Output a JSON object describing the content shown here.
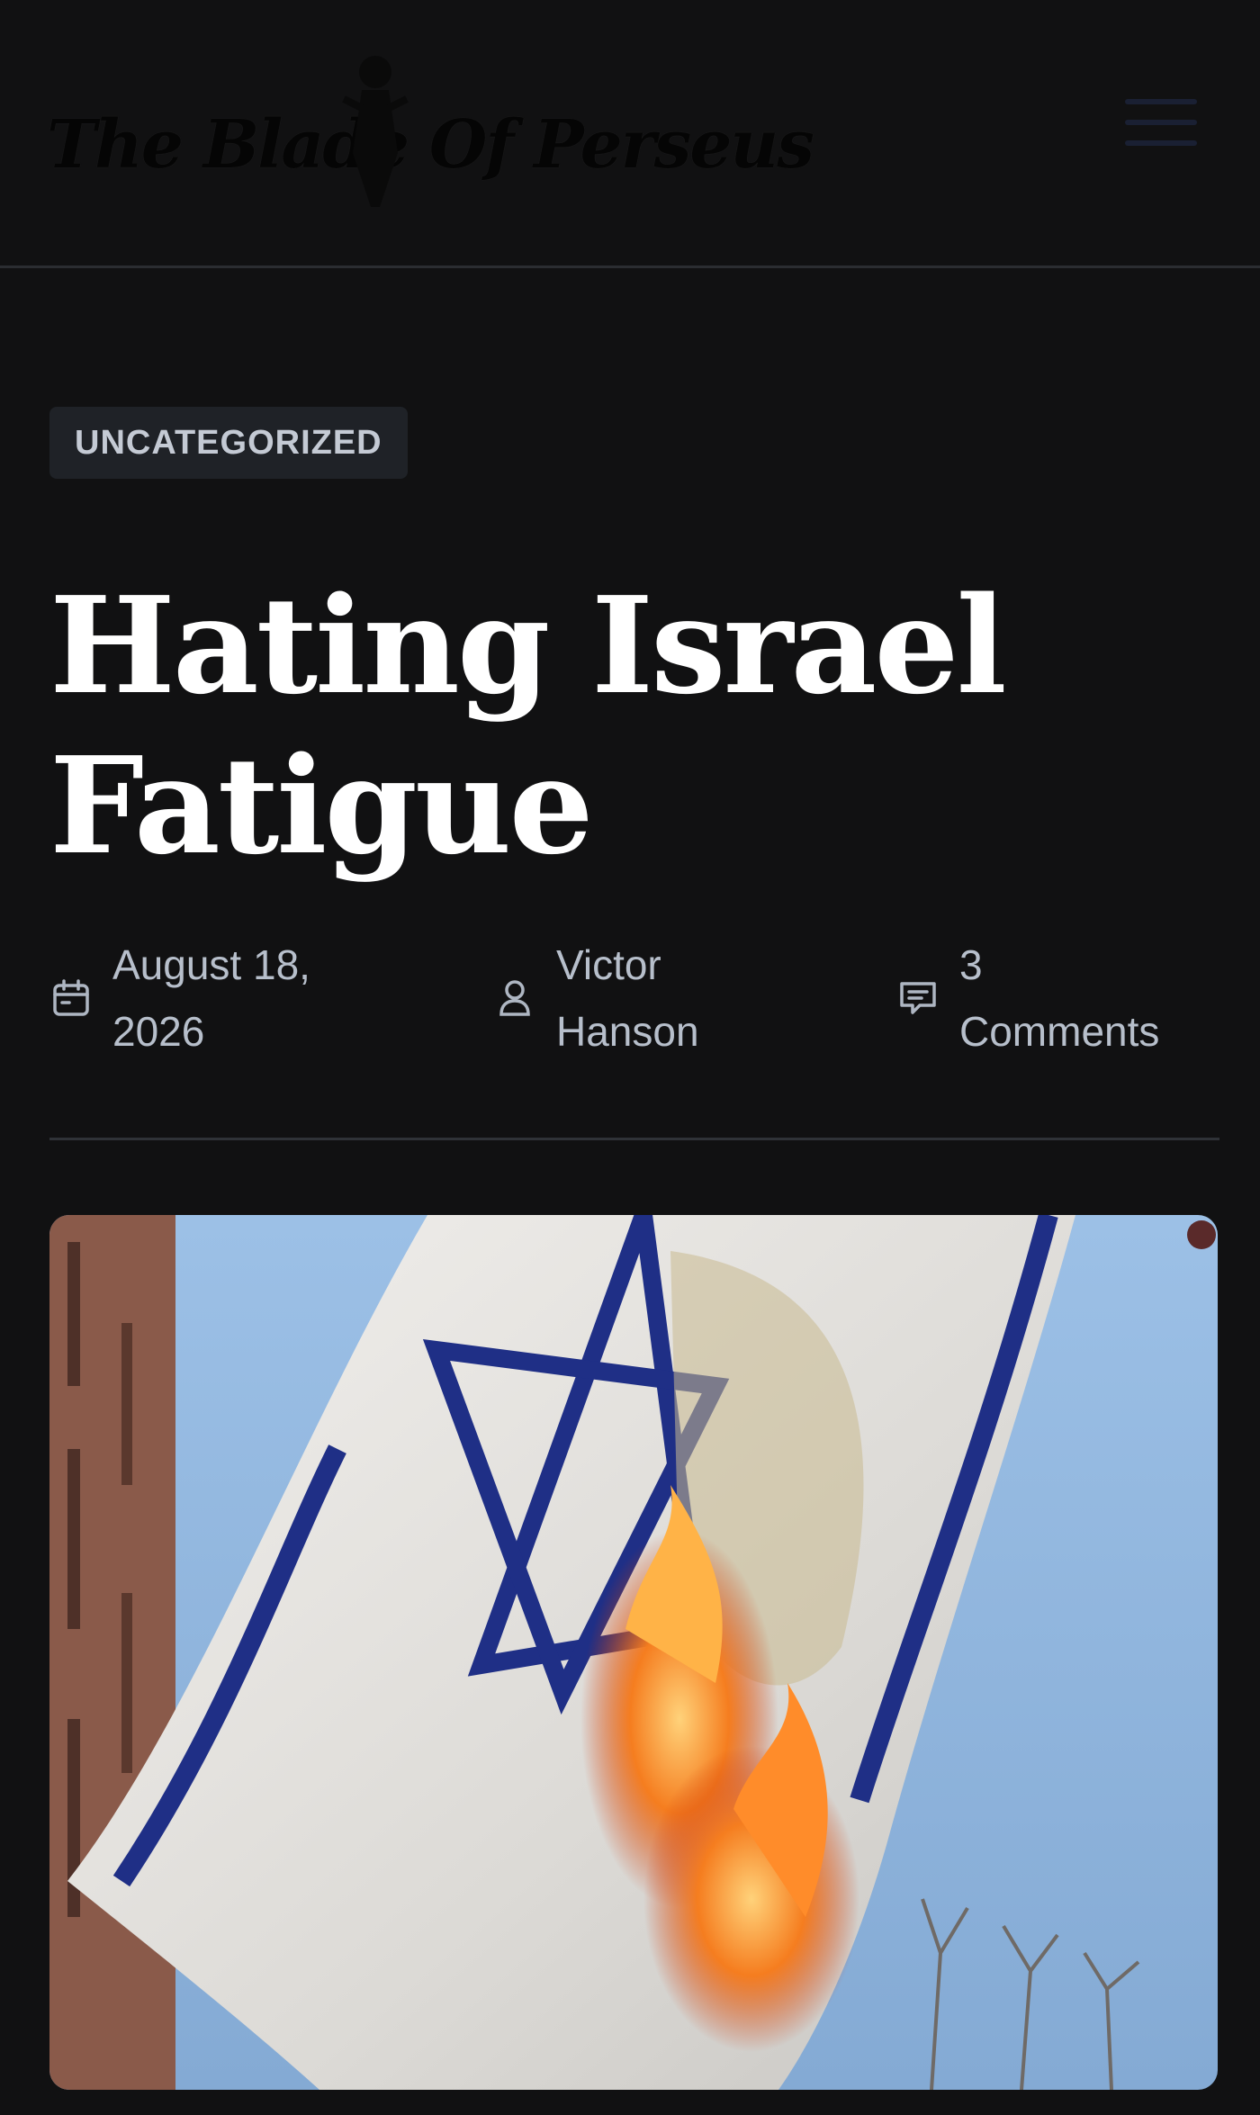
{
  "header": {
    "logo_text": "The Blade Of Perseus",
    "menu_icon": "hamburger-menu-icon"
  },
  "post": {
    "category": "UNCATEGORIZED",
    "title_line1": "Hating Israel",
    "title_line2": "Fatigue",
    "date_line1": "August 18,",
    "date_line2": "2026",
    "date_icon": "calendar-icon",
    "author_line1": "Victor",
    "author_line2": "Hanson",
    "author_icon": "user-icon",
    "comments_line1": "3",
    "comments_line2": "Comments",
    "comments_icon": "comment-icon"
  },
  "featured_image": {
    "subject": "burning-flag-photo",
    "sky_color": "#8fb5db",
    "flag_color": "#ece9e4",
    "stripe_color": "#1f2f86",
    "fire_color": "#f0661a"
  }
}
